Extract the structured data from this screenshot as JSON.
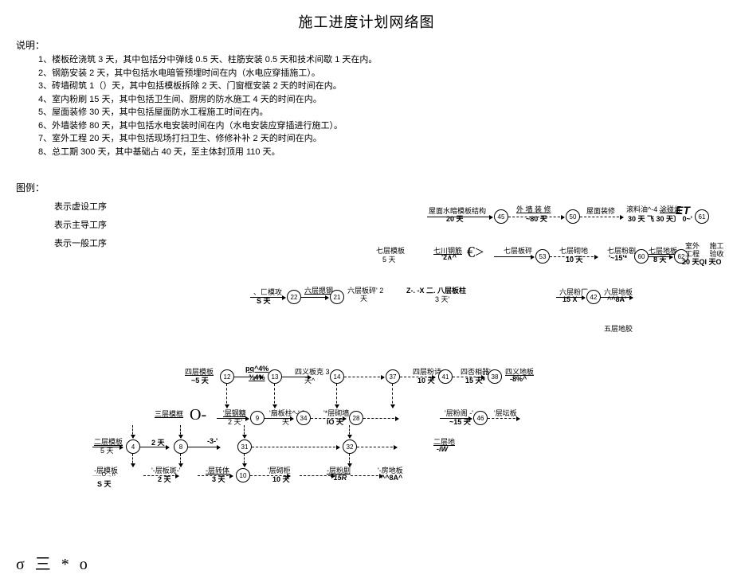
{
  "title": "施工进度计划网络图",
  "shuoming_label": "说明：",
  "shuoming": [
    "1、楼板砼浇筑 3 天，其中包括分中弹线 0.5 天、柱筋安装 0.5 天和技术间歇 1 天在内。",
    "2、钢筋安装 2 天，其中包括水电暗管预埋时间在内（水电应穿插施工）。",
    "3、砖墙砌筑 1（）天，其中包括模板拆除 2 天、门窗框安装 2 天的时间在内。",
    "4、室内粉刷 15 天，其中包括卫生间、厨房的防水施工 4 天的时间在内。",
    "5、屋面装修 30 天，其中包括屋面防水工程施工时间在内。",
    "6、外墙装修 80 天，其中包括水电安装时间在内（水电安装应穿插进行施工）。",
    "7、室外工程 20 天，其中包括现场打扫卫生、修修补补 2 天的时间在内。",
    "8、总工期 300 天，其中基础占 40 天，至主体封顶用 110 天。"
  ],
  "tuli_label": "图例：",
  "tuli_rows": [
    "表示虚设工序",
    "表示主导工序",
    "表示一般工序"
  ],
  "row1": {
    "a": "屋面水暗模板结构",
    "ad": "20 天",
    "n1": "45",
    "b": "外 墙 装 修",
    "bd": "~80 天",
    "n2": "50",
    "c": "屋面装修",
    "d": "滚料油^-4→",
    "e": "涂碰灯",
    "et": "ET",
    "dd": "30 天 飞 30 天〕 0~'",
    "n3": "61"
  },
  "row2": {
    "a": "七层模板",
    "ad": "5 天",
    "b": "七川钢筋",
    "bd": "'2∧^",
    "eur": "€>",
    "c": "七层板砰",
    "n1": "53",
    "d": "七层砌地",
    "dd": "10 天",
    "e": "七层粉剧",
    "ed": "'~15'*",
    "n2": "60",
    "f": "七层地板",
    "fd": "8 天",
    "n3": "62",
    "g": "室外     施工",
    "gd": "工程     验收",
    "h": "20 天QI 天O"
  },
  "row3": {
    "a": "、匚模攻",
    "ad": "S 天",
    "n1": "22",
    "b": "六层摁钢",
    "n2": "21",
    "c": "六层板砰' 2",
    "cd": "天",
    "d": "Z-. -X 二.  八层板柱",
    "dd": "3 天'",
    "e": "六层粉厂",
    "ed": "15 X",
    "n3": "42",
    "f": "六层地板",
    "fd": "^^8A'"
  },
  "row3b": "五层地胶",
  "row4": {
    "a": "四层模板",
    "ad": "~5 天",
    "n1": "12",
    "b": "pq^4%",
    "bd": "¾4%",
    "n2": "13",
    "c": "四义板克 3",
    "cd": "天^",
    "n3": "14",
    "n4": "37",
    "d": "四层粉诗",
    "dd": "10 天",
    "n5": "41",
    "e": "四否相器'",
    "ed": "15 天*",
    "n6": "38",
    "f": "四义地板",
    "fd": "-8%^"
  },
  "row5": {
    "a": "三层模框",
    "ad": "",
    "O": "O-",
    "b": "'层钢糖",
    "bd": "2 天'",
    "n1": "9",
    "c": "'扇板柱^-' 3",
    "cd": "天",
    "n2": "34",
    "d": "'*层砌墙",
    "dd": "IO 天",
    "n3": "28",
    "n4": "46",
    "e": "'层粉阁 -'",
    "ed": "~15 天",
    "f": "'层坛板"
  },
  "row6": {
    "a": "二层模板",
    "ad": "5 天",
    "n1": "4",
    "b": "2 天",
    "n2": "8",
    "c": "-3-'",
    "n3": "31",
    "n4": "32",
    "d": "二层地",
    "dd": "-iW"
  },
  "row7": {
    "a": "-层模板",
    "ad": "......O ., n",
    "aN": "S 天",
    "b": "'-层板斑-'",
    "bd": "2 天",
    "c": "-层转体",
    "cd": "3 天",
    "n1": "10",
    "d": "'层砌柜",
    "dd": "10 天",
    "e": "-层粉剧",
    "ed": "' 15R",
    "f": "'-房地板",
    "fd": "^^8A^"
  },
  "bottom": "σ 三 * o"
}
